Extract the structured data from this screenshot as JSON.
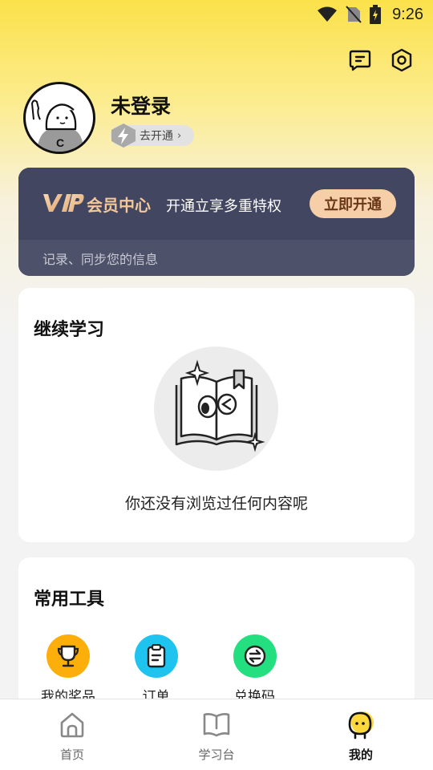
{
  "status_bar": {
    "time": "9:26",
    "icons": [
      "wifi-icon",
      "no-sim-icon",
      "battery-charging-icon"
    ]
  },
  "header": {
    "message_icon": "message-icon",
    "settings_icon": "settings-icon"
  },
  "profile": {
    "username": "未登录",
    "vip_badge_label": "去开通",
    "vip_badge_chevron": "›"
  },
  "vip_card": {
    "logo_text": "VIP",
    "title": "会员中心",
    "subtitle": "开通立享多重特权",
    "button_label": "立即开通",
    "note": "记录、同步您的信息",
    "colors": {
      "card": "#424660",
      "accent": "#f3c89a",
      "button": "#f6cfa9"
    }
  },
  "continue_learning": {
    "title": "继续学习",
    "empty_text": "你还没有浏览过任何内容呢"
  },
  "tools": {
    "title": "常用工具",
    "items": [
      {
        "label": "我的奖品",
        "icon": "trophy-icon",
        "color": "#fcae0a"
      },
      {
        "label": "订单",
        "icon": "clipboard-icon",
        "color": "#1ec3f0"
      },
      {
        "label": "兑换码",
        "icon": "exchange-icon",
        "color": "#23df7f"
      }
    ]
  },
  "bottom_nav": {
    "items": [
      {
        "label": "首页",
        "icon": "home-icon",
        "active": false
      },
      {
        "label": "学习台",
        "icon": "book-icon",
        "active": false
      },
      {
        "label": "我的",
        "icon": "profile-face-icon",
        "active": true
      }
    ]
  }
}
